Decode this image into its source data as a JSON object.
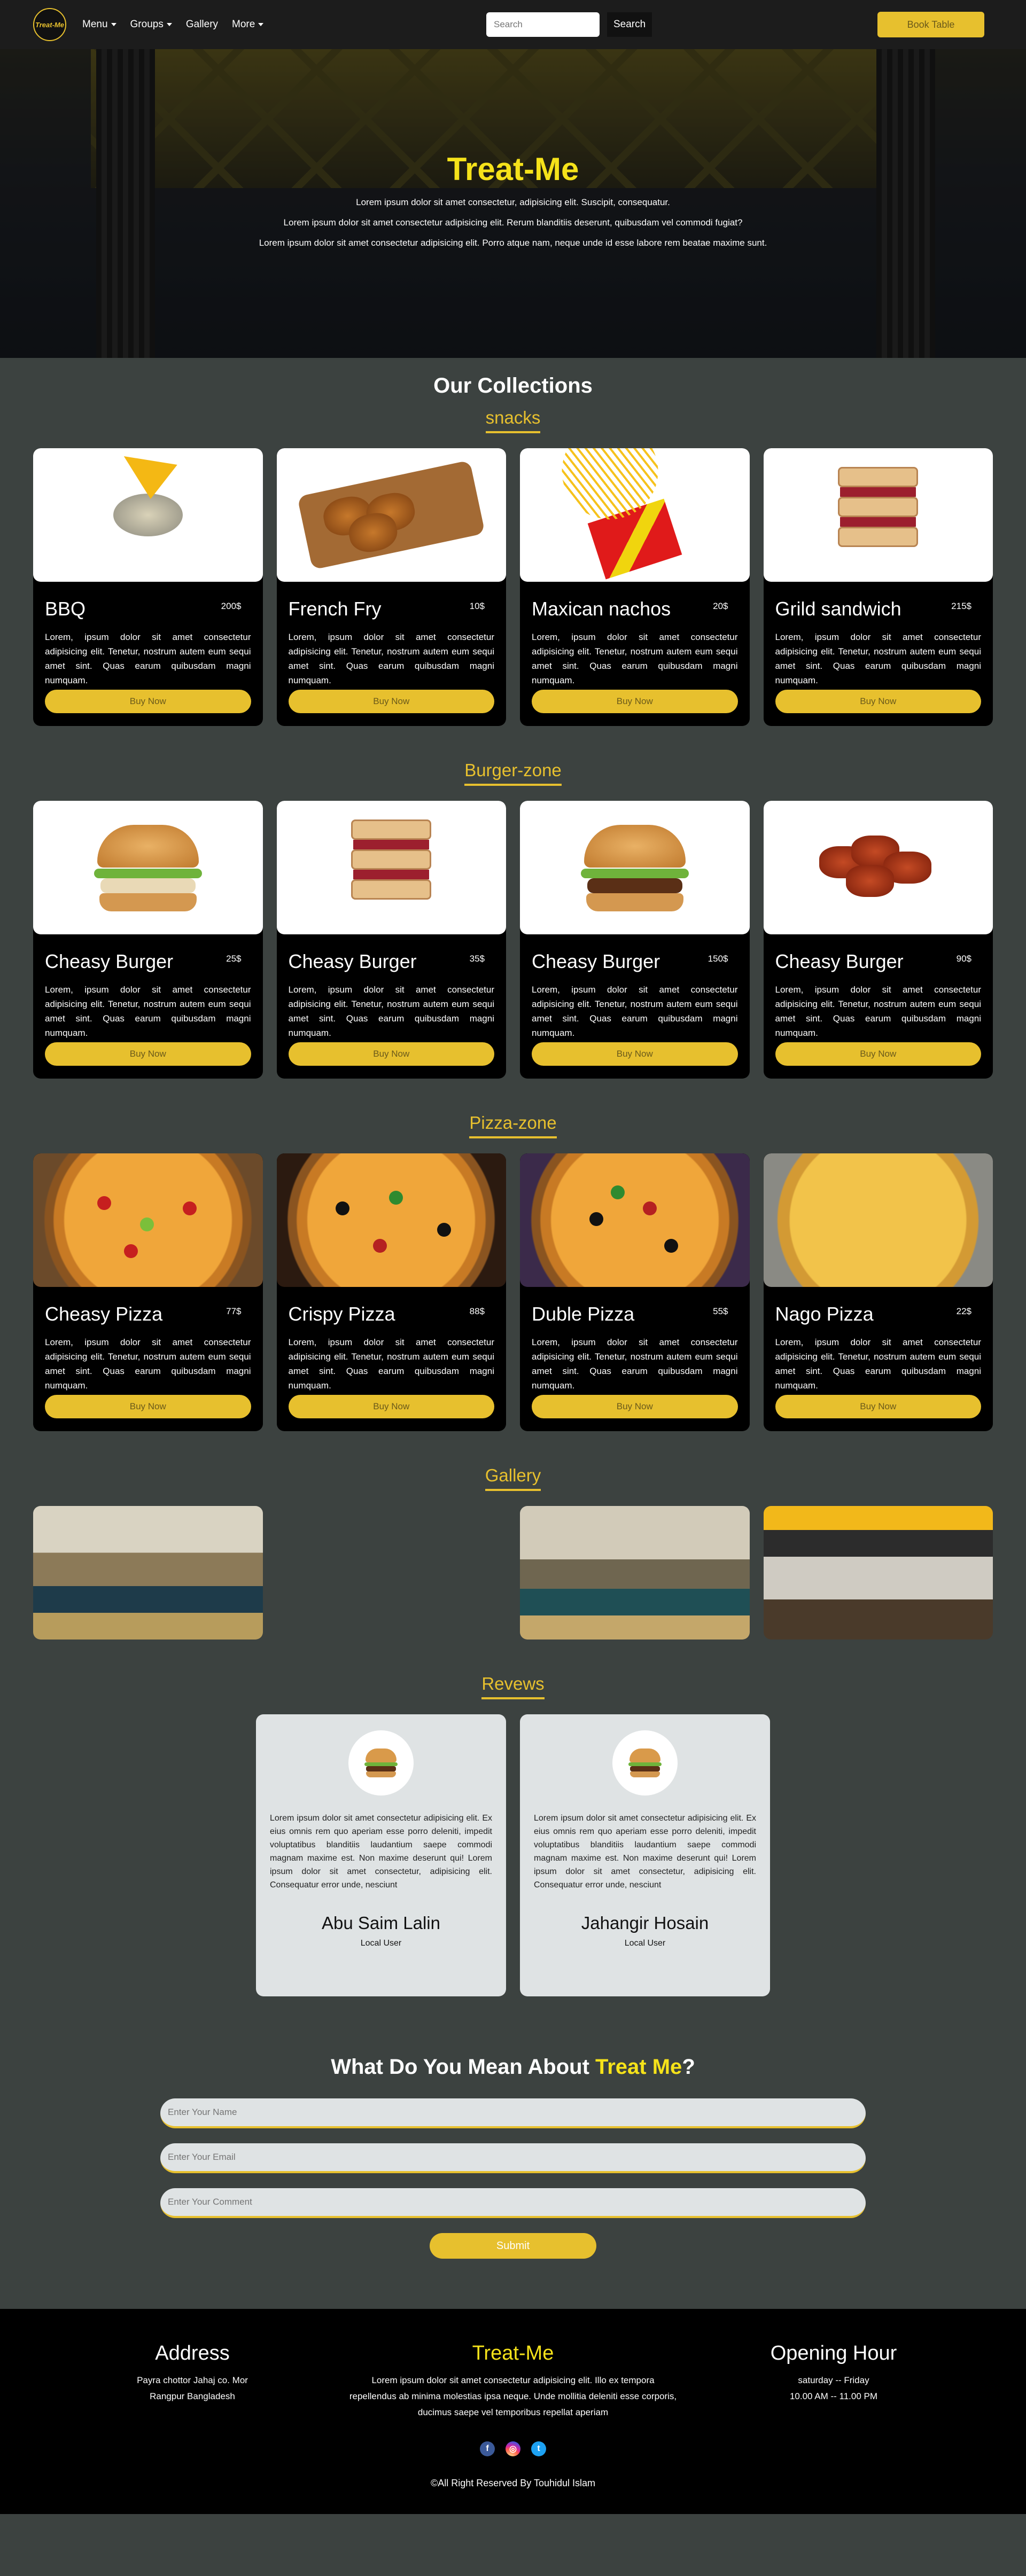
{
  "nav": {
    "logo_text": "Treat-Me",
    "links": [
      {
        "label": "Menu",
        "dropdown": true
      },
      {
        "label": "Groups",
        "dropdown": true
      },
      {
        "label": "Gallery",
        "dropdown": false
      },
      {
        "label": "More",
        "dropdown": true
      }
    ],
    "search_placeholder": "Search",
    "search_button": "Search",
    "book_button": "Book Table"
  },
  "hero": {
    "title": "Treat-Me",
    "lines": [
      "Lorem ipsum dolor sit amet consectetur, adipisicing elit. Suscipit, consequatur.",
      "Lorem ipsum dolor sit amet consectetur adipisicing elit. Rerum blanditiis deserunt, quibusdam vel commodi fugiat?",
      "Lorem ipsum dolor sit amet consectetur adipisicing elit. Porro atque nam, neque unde id esse labore rem beatae maxime sunt."
    ]
  },
  "collections": {
    "title": "Our Collections",
    "card_desc": "Lorem, ipsum dolor sit amet consectetur adipisicing elit. Tenetur, nostrum autem eum sequi amet sint. Quas earum quibusdam magni numquam.",
    "buy_label": "Buy Now",
    "snacks": {
      "heading": "snacks",
      "items": [
        {
          "name": "BBQ",
          "price": "200$"
        },
        {
          "name": "French Fry",
          "price": "10$"
        },
        {
          "name": "Maxican nachos",
          "price": "20$"
        },
        {
          "name": "Grild sandwich",
          "price": "215$"
        }
      ]
    },
    "burger": {
      "heading": "Burger-zone",
      "items": [
        {
          "name": "Cheasy Burger",
          "price": "25$"
        },
        {
          "name": "Cheasy Burger",
          "price": "35$"
        },
        {
          "name": "Cheasy Burger",
          "price": "150$"
        },
        {
          "name": "Cheasy Burger",
          "price": "90$"
        }
      ]
    },
    "pizza": {
      "heading": "Pizza-zone",
      "items": [
        {
          "name": "Cheasy Pizza",
          "price": "77$"
        },
        {
          "name": "Crispy Pizza",
          "price": "88$"
        },
        {
          "name": "Duble Pizza",
          "price": "55$"
        },
        {
          "name": "Nago Pizza",
          "price": "22$"
        }
      ]
    }
  },
  "gallery": {
    "heading": "Gallery"
  },
  "reviews": {
    "heading": "Revews",
    "text": "Lorem ipsum dolor sit amet consectetur adipisicing elit. Ex eius omnis rem quo aperiam esse porro deleniti, impedit voluptatibus blanditiis laudantium saepe commodi magnam maxime est. Non maxime deserunt qui! Lorem ipsum dolor sit amet consectetur, adipisicing elit. Consequatur error unde, nesciunt",
    "items": [
      {
        "name": "Abu Saim Lalin",
        "role": "Local User"
      },
      {
        "name": "Jahangir Hosain",
        "role": "Local User"
      }
    ]
  },
  "contact": {
    "title_prefix": "What Do You Mean About ",
    "title_accent": "Treat Me",
    "title_suffix": "?",
    "name_placeholder": "Enter Your Name",
    "email_placeholder": "Enter Your Email",
    "comment_placeholder": "Enter Your Comment",
    "submit_label": "Submit"
  },
  "footer": {
    "address_title": "Address",
    "address_line1": "Payra chottor Jahaj co. Mor",
    "address_line2": "Rangpur Bangladesh",
    "brand_title": "Treat-Me",
    "brand_text": "Lorem ipsum dolor sit amet consectetur adipisicing elit. Illo ex tempora repellendus ab minima molestias ipsa neque. Unde mollitia deleniti esse corporis, ducimus saepe vel temporibus repellat aperiam",
    "hours_title": "Opening Hour",
    "hours_days": "saturday -- Friday",
    "hours_time": "10.00 AM -- 11.00 PM",
    "copyright": "©All Right Reserved By Touhidul Islam",
    "social_icons": [
      "facebook-icon",
      "instagram-icon",
      "twitter-icon"
    ]
  },
  "colors": {
    "accent": "#e7c02e",
    "hero_title": "#f5e21a",
    "page_bg": "#3c4240",
    "card_bg": "#000000",
    "review_bg": "#dfe3e4"
  }
}
